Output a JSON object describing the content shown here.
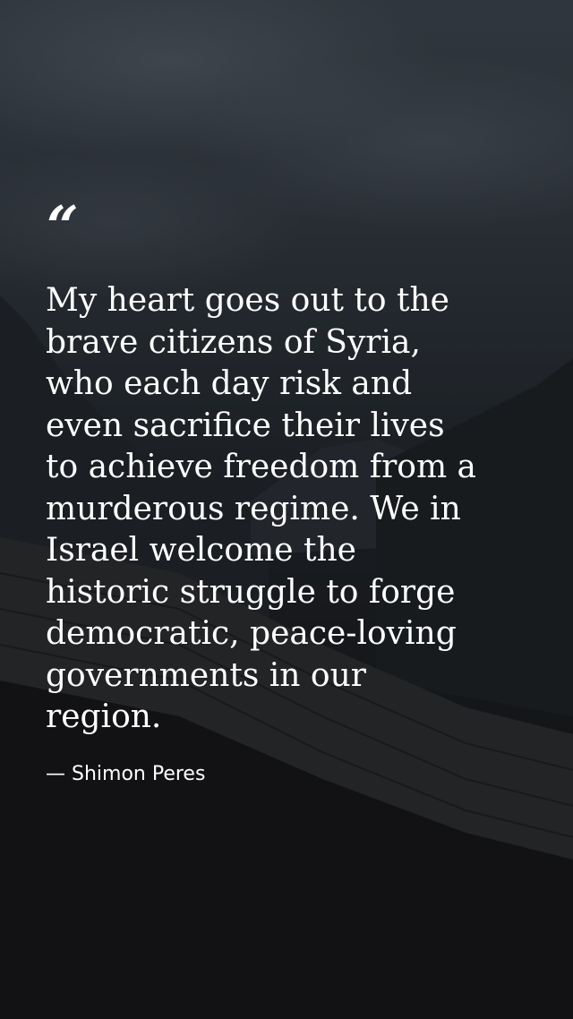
{
  "quote": {
    "mark": "“",
    "text": "My heart goes out to the\nbrave citizens of Syria,\nwho each day risk and\neven sacrifice their lives\nto achieve freedom from a\nmurderous regime. We in\nIsrael welcome the\nhistoric struggle to forge\ndemocratic, peace-loving\ngovernments in our\nregion.",
    "author": "— Shimon Peres"
  },
  "colors": {
    "text": "#ffffff",
    "sky": "#343c44",
    "ground": "#131415"
  }
}
